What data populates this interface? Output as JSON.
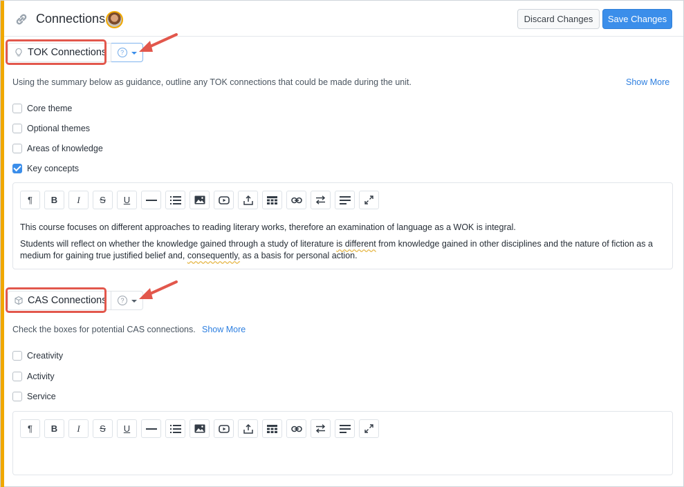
{
  "header": {
    "title": "Connections",
    "discard_label": "Discard Changes",
    "save_label": "Save Changes"
  },
  "tok": {
    "title": "TOK Connections",
    "icon": "lightbulb-icon",
    "help": "?",
    "guidance": "Using the summary below as guidance, outline any TOK connections that could be made during the unit.",
    "show_more": "Show More",
    "checkboxes": [
      {
        "label": "Core theme",
        "checked": false
      },
      {
        "label": "Optional themes",
        "checked": false
      },
      {
        "label": "Areas of knowledge",
        "checked": false
      },
      {
        "label": "Key concepts",
        "checked": true
      }
    ],
    "editor": {
      "p1": "This course focuses on different approaches to reading literary works, therefore an examination of language as a WOK is integral.",
      "p2_a": "Students will reflect on whether the knowledge gained through a study of literature ",
      "p2_b": "is different",
      "p2_c": " from knowledge gained in other disciplines and the nature of fiction as a medium for gaining true justified belief and, ",
      "p2_d": "consequently,",
      "p2_e": " as a basis for personal action."
    }
  },
  "cas": {
    "title": "CAS Connections",
    "icon": "cube-icon",
    "help": "?",
    "guidance": "Check the boxes for potential CAS connections.",
    "show_more": "Show More",
    "checkboxes": [
      {
        "label": "Creativity",
        "checked": false
      },
      {
        "label": "Activity",
        "checked": false
      },
      {
        "label": "Service",
        "checked": false
      }
    ]
  },
  "toolbar": {
    "paragraph": "¶",
    "bold": "B",
    "italic": "I",
    "strike": "S",
    "underline": "U"
  },
  "colors": {
    "accent": "#f0a800",
    "primary": "#3b8eea",
    "link": "#2d7fe0",
    "annotation": "#e2574c"
  }
}
